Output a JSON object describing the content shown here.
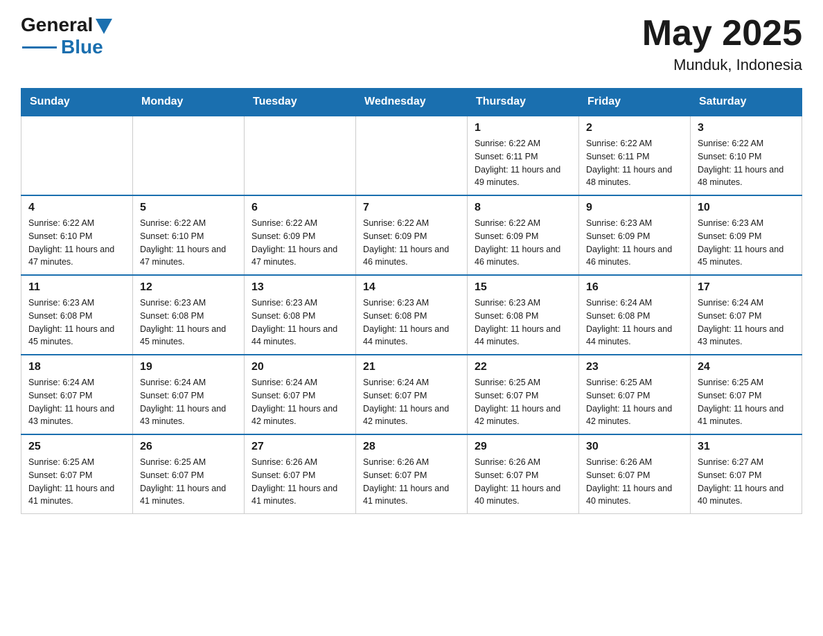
{
  "header": {
    "logo_general": "General",
    "logo_blue": "Blue",
    "title": "May 2025",
    "subtitle": "Munduk, Indonesia"
  },
  "days_of_week": [
    "Sunday",
    "Monday",
    "Tuesday",
    "Wednesday",
    "Thursday",
    "Friday",
    "Saturday"
  ],
  "weeks": [
    [
      {
        "day": "",
        "info": ""
      },
      {
        "day": "",
        "info": ""
      },
      {
        "day": "",
        "info": ""
      },
      {
        "day": "",
        "info": ""
      },
      {
        "day": "1",
        "info": "Sunrise: 6:22 AM\nSunset: 6:11 PM\nDaylight: 11 hours and 49 minutes."
      },
      {
        "day": "2",
        "info": "Sunrise: 6:22 AM\nSunset: 6:11 PM\nDaylight: 11 hours and 48 minutes."
      },
      {
        "day": "3",
        "info": "Sunrise: 6:22 AM\nSunset: 6:10 PM\nDaylight: 11 hours and 48 minutes."
      }
    ],
    [
      {
        "day": "4",
        "info": "Sunrise: 6:22 AM\nSunset: 6:10 PM\nDaylight: 11 hours and 47 minutes."
      },
      {
        "day": "5",
        "info": "Sunrise: 6:22 AM\nSunset: 6:10 PM\nDaylight: 11 hours and 47 minutes."
      },
      {
        "day": "6",
        "info": "Sunrise: 6:22 AM\nSunset: 6:09 PM\nDaylight: 11 hours and 47 minutes."
      },
      {
        "day": "7",
        "info": "Sunrise: 6:22 AM\nSunset: 6:09 PM\nDaylight: 11 hours and 46 minutes."
      },
      {
        "day": "8",
        "info": "Sunrise: 6:22 AM\nSunset: 6:09 PM\nDaylight: 11 hours and 46 minutes."
      },
      {
        "day": "9",
        "info": "Sunrise: 6:23 AM\nSunset: 6:09 PM\nDaylight: 11 hours and 46 minutes."
      },
      {
        "day": "10",
        "info": "Sunrise: 6:23 AM\nSunset: 6:09 PM\nDaylight: 11 hours and 45 minutes."
      }
    ],
    [
      {
        "day": "11",
        "info": "Sunrise: 6:23 AM\nSunset: 6:08 PM\nDaylight: 11 hours and 45 minutes."
      },
      {
        "day": "12",
        "info": "Sunrise: 6:23 AM\nSunset: 6:08 PM\nDaylight: 11 hours and 45 minutes."
      },
      {
        "day": "13",
        "info": "Sunrise: 6:23 AM\nSunset: 6:08 PM\nDaylight: 11 hours and 44 minutes."
      },
      {
        "day": "14",
        "info": "Sunrise: 6:23 AM\nSunset: 6:08 PM\nDaylight: 11 hours and 44 minutes."
      },
      {
        "day": "15",
        "info": "Sunrise: 6:23 AM\nSunset: 6:08 PM\nDaylight: 11 hours and 44 minutes."
      },
      {
        "day": "16",
        "info": "Sunrise: 6:24 AM\nSunset: 6:08 PM\nDaylight: 11 hours and 44 minutes."
      },
      {
        "day": "17",
        "info": "Sunrise: 6:24 AM\nSunset: 6:07 PM\nDaylight: 11 hours and 43 minutes."
      }
    ],
    [
      {
        "day": "18",
        "info": "Sunrise: 6:24 AM\nSunset: 6:07 PM\nDaylight: 11 hours and 43 minutes."
      },
      {
        "day": "19",
        "info": "Sunrise: 6:24 AM\nSunset: 6:07 PM\nDaylight: 11 hours and 43 minutes."
      },
      {
        "day": "20",
        "info": "Sunrise: 6:24 AM\nSunset: 6:07 PM\nDaylight: 11 hours and 42 minutes."
      },
      {
        "day": "21",
        "info": "Sunrise: 6:24 AM\nSunset: 6:07 PM\nDaylight: 11 hours and 42 minutes."
      },
      {
        "day": "22",
        "info": "Sunrise: 6:25 AM\nSunset: 6:07 PM\nDaylight: 11 hours and 42 minutes."
      },
      {
        "day": "23",
        "info": "Sunrise: 6:25 AM\nSunset: 6:07 PM\nDaylight: 11 hours and 42 minutes."
      },
      {
        "day": "24",
        "info": "Sunrise: 6:25 AM\nSunset: 6:07 PM\nDaylight: 11 hours and 41 minutes."
      }
    ],
    [
      {
        "day": "25",
        "info": "Sunrise: 6:25 AM\nSunset: 6:07 PM\nDaylight: 11 hours and 41 minutes."
      },
      {
        "day": "26",
        "info": "Sunrise: 6:25 AM\nSunset: 6:07 PM\nDaylight: 11 hours and 41 minutes."
      },
      {
        "day": "27",
        "info": "Sunrise: 6:26 AM\nSunset: 6:07 PM\nDaylight: 11 hours and 41 minutes."
      },
      {
        "day": "28",
        "info": "Sunrise: 6:26 AM\nSunset: 6:07 PM\nDaylight: 11 hours and 41 minutes."
      },
      {
        "day": "29",
        "info": "Sunrise: 6:26 AM\nSunset: 6:07 PM\nDaylight: 11 hours and 40 minutes."
      },
      {
        "day": "30",
        "info": "Sunrise: 6:26 AM\nSunset: 6:07 PM\nDaylight: 11 hours and 40 minutes."
      },
      {
        "day": "31",
        "info": "Sunrise: 6:27 AM\nSunset: 6:07 PM\nDaylight: 11 hours and 40 minutes."
      }
    ]
  ]
}
